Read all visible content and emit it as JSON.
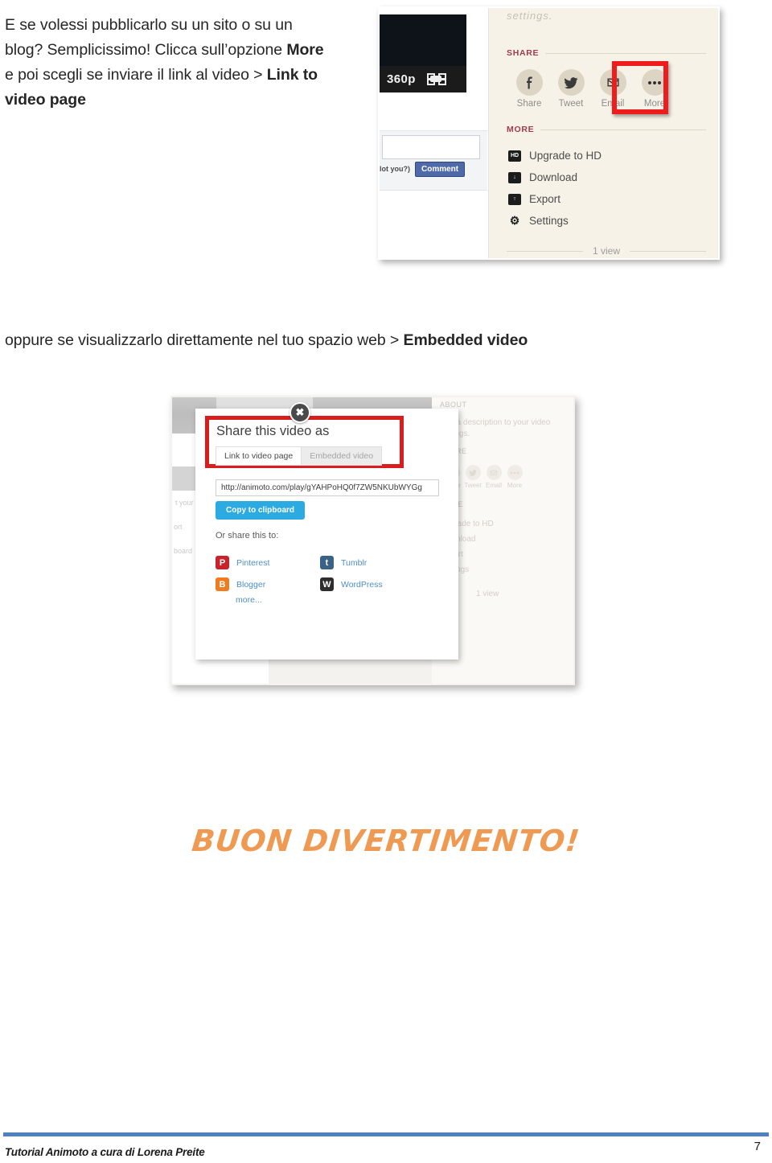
{
  "document": {
    "intro_paragraph": {
      "line1": "E se volessi pubblicarlo su un sito o su un",
      "line2_a": "blog? Semplicissimo! Clicca sull’opzione ",
      "line2_bold": "More",
      "line3_a": "e poi scegli se inviare il link al video > ",
      "line3_bold": "Link to",
      "line4_bold": "video page"
    },
    "middle_paragraph": {
      "text": "oppure se visualizzarlo direttamente nel tuo spazio web > ",
      "bold": "Embedded video"
    },
    "closing_text": "BUON DIVERTIMENTO!",
    "footer": {
      "credit": "Tutorial Animoto a cura di Lorena Preite",
      "page_number": "7"
    },
    "accent_colors": {
      "footer_rule": "#4F81BD",
      "highlight_box": "#EE1C1C",
      "closing_text": "#EF9A52",
      "copy_button": "#2CABE3",
      "link_blue": "#4D8FC4"
    }
  },
  "screenshot_one": {
    "player": {
      "resolution_label": "360p",
      "fullscreen_icon": "fullscreen-icon"
    },
    "comment_box": {
      "hint_text": "lot you?)",
      "button_label": "Comment"
    },
    "ghost_settings_text": "settings.",
    "share_section": {
      "heading": "SHARE",
      "items": [
        {
          "label": "Share",
          "icon": "facebook-icon"
        },
        {
          "label": "Tweet",
          "icon": "twitter-icon"
        },
        {
          "label": "Email",
          "icon": "envelope-icon"
        },
        {
          "label": "More",
          "icon": "ellipsis-icon"
        }
      ]
    },
    "more_section": {
      "heading": "MORE",
      "items": [
        {
          "label": "Upgrade to HD",
          "icon": "hd-badge-icon",
          "glyph": "HD"
        },
        {
          "label": "Download",
          "icon": "download-arrow-icon",
          "glyph": "↓"
        },
        {
          "label": "Export",
          "icon": "export-arrow-icon",
          "glyph": "↑"
        },
        {
          "label": "Settings",
          "icon": "gear-icon",
          "glyph": "⚙"
        }
      ]
    },
    "view_count": "1 view"
  },
  "screenshot_two": {
    "close_icon": "close-icon",
    "dialog": {
      "title": "Share this video as",
      "tabs": [
        {
          "label": "Link to video page",
          "active": true
        },
        {
          "label": "Embedded video",
          "active": false
        }
      ],
      "url_value": "http://animoto.com/play/gYAHPoHQ0f7ZW5NKUbWYGg",
      "copy_button": "Copy to clipboard",
      "share_prompt": "Or share this to:",
      "social_links": [
        {
          "label": "Pinterest",
          "icon": "pinterest-icon",
          "glyph": "P",
          "color": "#C8232C"
        },
        {
          "label": "Tumblr",
          "icon": "tumblr-icon",
          "glyph": "t",
          "color": "#3A6186"
        },
        {
          "label": "Blogger",
          "icon": "blogger-icon",
          "glyph": "B",
          "color": "#F07C20"
        },
        {
          "label": "WordPress",
          "icon": "wordpress-icon",
          "glyph": "W",
          "color": "#2D2D2D"
        }
      ],
      "more_link": "more..."
    },
    "background_page": {
      "about_heading": "ABOUT",
      "about_line1": "Add a description to your video",
      "about_line2": "settings.",
      "share_heading": "SHARE",
      "share_items": [
        {
          "label": "Share",
          "icon": "facebook-icon"
        },
        {
          "label": "Tweet",
          "icon": "twitter-icon"
        },
        {
          "label": "Email",
          "icon": "envelope-icon"
        },
        {
          "label": "More",
          "icon": "ellipsis-icon"
        }
      ],
      "more_heading": "MORE",
      "more_items": [
        "Upgrade to HD",
        "Download",
        "Export",
        "Settings"
      ],
      "view_count": "1 view"
    }
  }
}
